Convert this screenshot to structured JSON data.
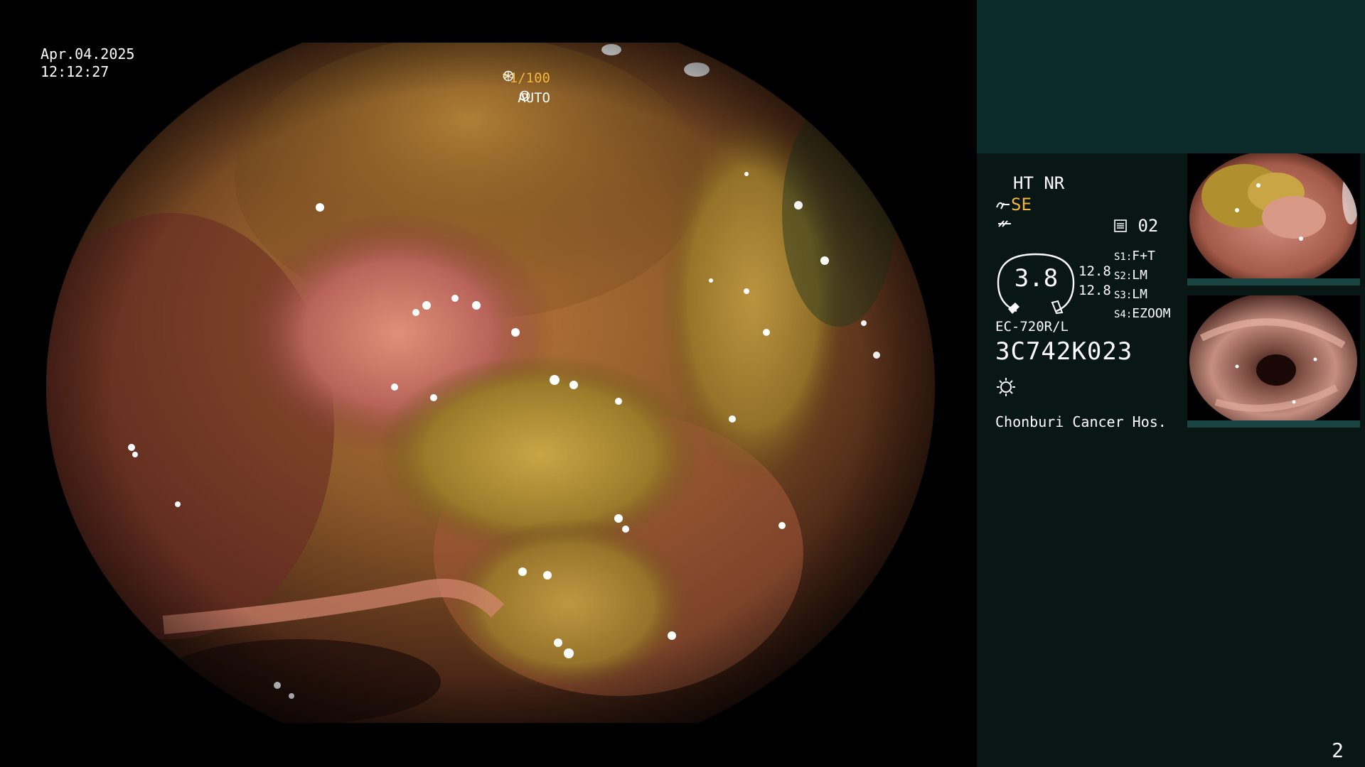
{
  "overlay": {
    "date": "Apr.04.2025",
    "time": "12:12:27",
    "shutter": "*1/100",
    "iris_mode": "AUTO"
  },
  "panel": {
    "enhancement_top": "HT NR",
    "structure_mode": "SE",
    "record_count": "02",
    "structure_value": "3.8",
    "level_1": "12.8",
    "level_2": "12.8",
    "switches": [
      {
        "key": "S1:",
        "value": "F+T"
      },
      {
        "key": "S2:",
        "value": "LM"
      },
      {
        "key": "S3:",
        "value": "LM"
      },
      {
        "key": "S4:",
        "value": "EZOOM"
      }
    ],
    "scope_model": "EC-720R/L",
    "scope_serial": "3C742K023",
    "hospital": "Chonburi Cancer Hos.",
    "page_number": "2"
  },
  "colors": {
    "panel_bg": "#081614",
    "panel_top_bg": "#0c2c2b",
    "accent_orange": "#f5b43c",
    "text": "#ffffff"
  },
  "icons": {
    "shutter_icon": "aperture-icon",
    "iris_icon": "iris-ring-icon",
    "se_icon": "structure-enhance-icon",
    "eq_icon": "equalizer-icon",
    "record_icon": "record-card-icon",
    "light_icon": "sun-light-icon"
  }
}
